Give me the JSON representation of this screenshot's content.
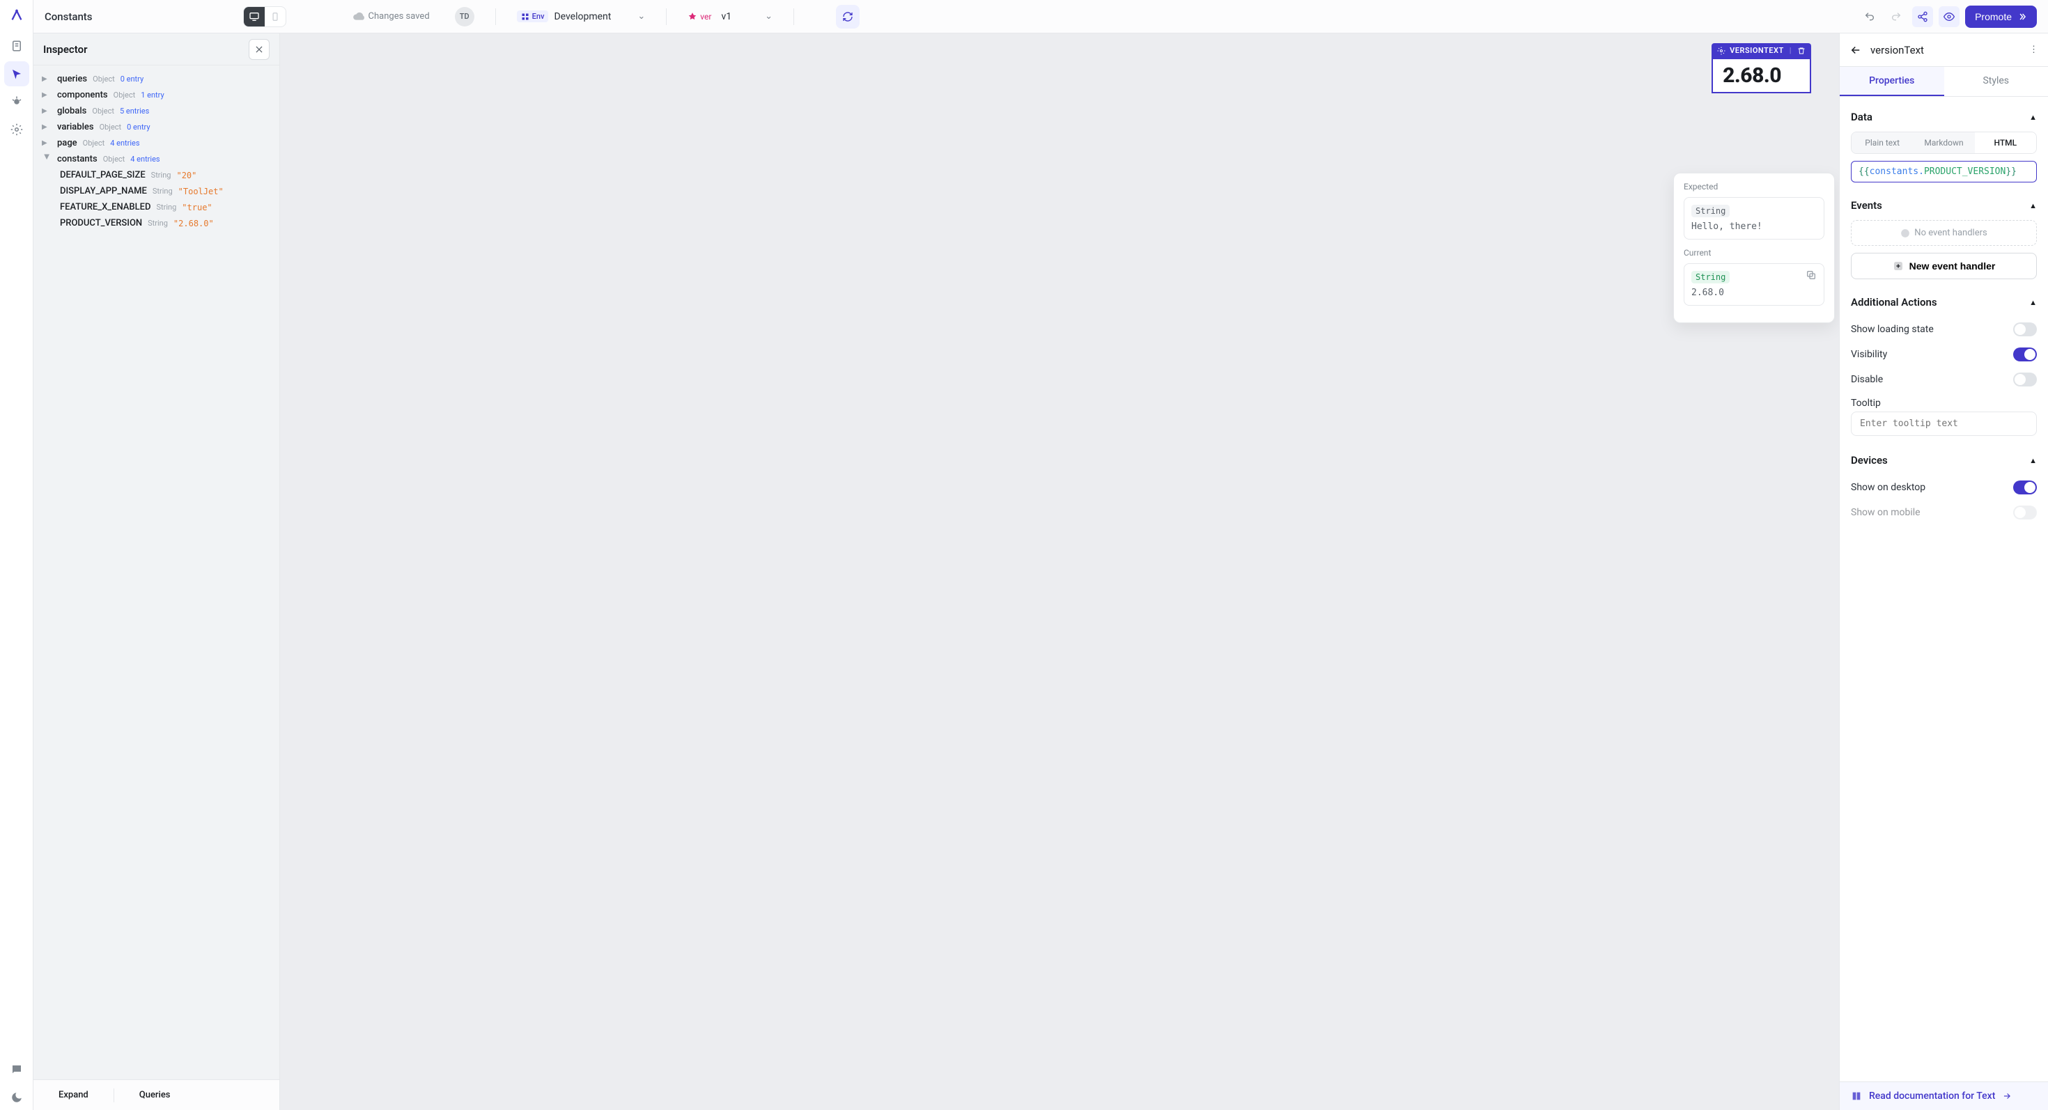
{
  "topbar": {
    "title": "Constants",
    "saved": "Changes saved",
    "avatar": "TD",
    "env_label": "Env",
    "env_name": "Development",
    "ver_label": "ver",
    "ver_name": "v1",
    "promote": "Promote"
  },
  "inspector": {
    "title": "Inspector",
    "nodes": [
      {
        "key": "queries",
        "type": "Object",
        "meta": "0 entry"
      },
      {
        "key": "components",
        "type": "Object",
        "meta": "1 entry"
      },
      {
        "key": "globals",
        "type": "Object",
        "meta": "5 entries"
      },
      {
        "key": "variables",
        "type": "Object",
        "meta": "0 entry"
      },
      {
        "key": "page",
        "type": "Object",
        "meta": "4 entries"
      }
    ],
    "constants_node": {
      "key": "constants",
      "type": "Object",
      "meta": "4 entries"
    },
    "constants": [
      {
        "key": "DEFAULT_PAGE_SIZE",
        "type": "String",
        "value": "\"20\""
      },
      {
        "key": "DISPLAY_APP_NAME",
        "type": "String",
        "value": "\"ToolJet\""
      },
      {
        "key": "FEATURE_X_ENABLED",
        "type": "String",
        "value": "\"true\""
      },
      {
        "key": "PRODUCT_VERSION",
        "type": "String",
        "value": "\"2.68.0\""
      }
    ],
    "footer": {
      "expand": "Expand",
      "queries": "Queries"
    }
  },
  "canvas": {
    "component_name": "VERSIONTEXT",
    "component_value": "2.68.0",
    "preview": {
      "expected_label": "Expected",
      "expected_type": "String",
      "expected_value": "Hello, there!",
      "current_label": "Current",
      "current_type": "String",
      "current_value": "2.68.0"
    }
  },
  "props": {
    "name": "versionText",
    "tabs": {
      "properties": "Properties",
      "styles": "Styles"
    },
    "data_section": "Data",
    "format_options": {
      "plain": "Plain text",
      "markdown": "Markdown",
      "html": "HTML"
    },
    "code": {
      "open": "{{",
      "obj": "constants",
      "dot": ".",
      "prop": "PRODUCT_VERSION",
      "close": "}}"
    },
    "events_section": "Events",
    "no_events": "No event handlers",
    "new_event": "New event handler",
    "additional_section": "Additional Actions",
    "rows": {
      "loading": "Show loading state",
      "visibility": "Visibility",
      "disable": "Disable",
      "tooltip": "Tooltip"
    },
    "tooltip_placeholder": "Enter tooltip text",
    "devices_section": "Devices",
    "show_desktop": "Show on desktop",
    "show_mobile": "Show on mobile",
    "doc_link": "Read documentation for Text"
  }
}
